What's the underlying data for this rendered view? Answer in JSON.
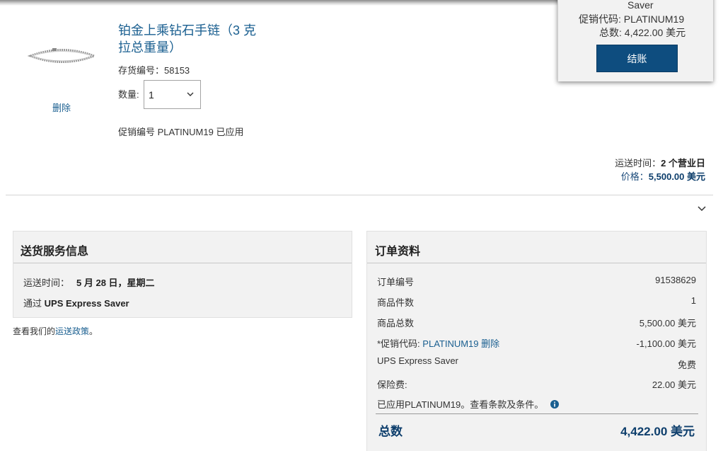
{
  "product": {
    "title": "铂金上乘钻石手链（3 克拉总重量）",
    "remove_label": "删除",
    "sku_label": "存货编号：",
    "sku_value": "58153",
    "qty_label": "数量:",
    "qty_value": "1",
    "promo_applied": "促销编号 PLATINUM19 已应用",
    "ship_time_label": "运送时间：",
    "ship_time_value": "2 个营业日",
    "price_label": "价格：",
    "price_value": "5,500.00 美元"
  },
  "floating_summary": {
    "saver_text": "Saver",
    "promo_label": "促销代码:",
    "promo_code": "PLATINUM19",
    "total_label": "总数:",
    "total_value": "4,422.00 美元",
    "checkout_label": "结账"
  },
  "delivery": {
    "heading": "送货服务信息",
    "date_label": "运送时间：",
    "date_value": "5 月 28 日，星期二",
    "via_label": "通过",
    "via_value": "UPS Express Saver",
    "policy_prefix": "查看我们的",
    "policy_link": "运送政策",
    "policy_suffix": "。"
  },
  "order": {
    "heading": "订单资料",
    "rows": [
      {
        "label": "订单编号",
        "value": "91538629"
      },
      {
        "label": "商品件数",
        "value": "1"
      },
      {
        "label": "商品总数",
        "value": "5,500.00 美元"
      },
      {
        "label": "*促销代码:",
        "code": "PLATINUM19 删除",
        "value": "-1,100.00 美元"
      },
      {
        "label": "UPS Express Saver",
        "value": "免费"
      },
      {
        "label": "保险费:",
        "value": "22.00 美元"
      }
    ],
    "promo_note": "已应用PLATINUM19。查看条款及条件。",
    "total_label": "总数",
    "total_value": "4,422.00 美元"
  },
  "colors": {
    "link": "#1a5f90",
    "checkout_button": "#0e4d7f",
    "panel_bg": "#f2f2f2",
    "total_text": "#0d3e6c"
  }
}
